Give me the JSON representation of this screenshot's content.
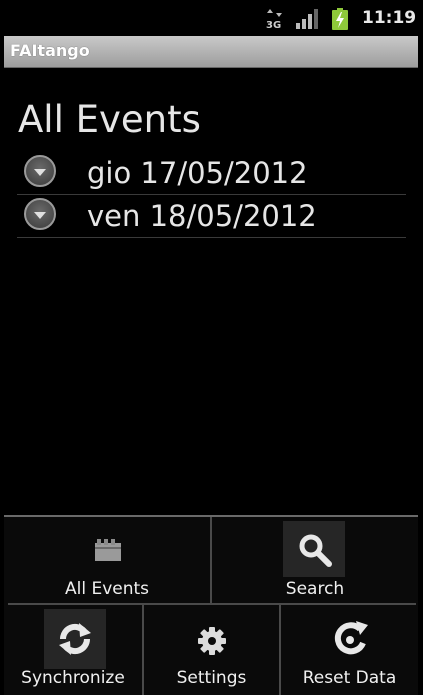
{
  "status_bar": {
    "network": "3G",
    "time": "11:19",
    "icons": [
      "network-3g-icon",
      "signal-icon",
      "battery-charging-icon"
    ]
  },
  "app": {
    "title": "FAItango"
  },
  "main": {
    "title": "All Events",
    "items": [
      {
        "label": "gio 17/05/2012"
      },
      {
        "label": "ven 18/05/2012"
      }
    ]
  },
  "menu": {
    "all_events": "All Events",
    "search": "Search",
    "synchronize": "Synchronize",
    "settings": "Settings",
    "reset_data": "Reset Data"
  }
}
